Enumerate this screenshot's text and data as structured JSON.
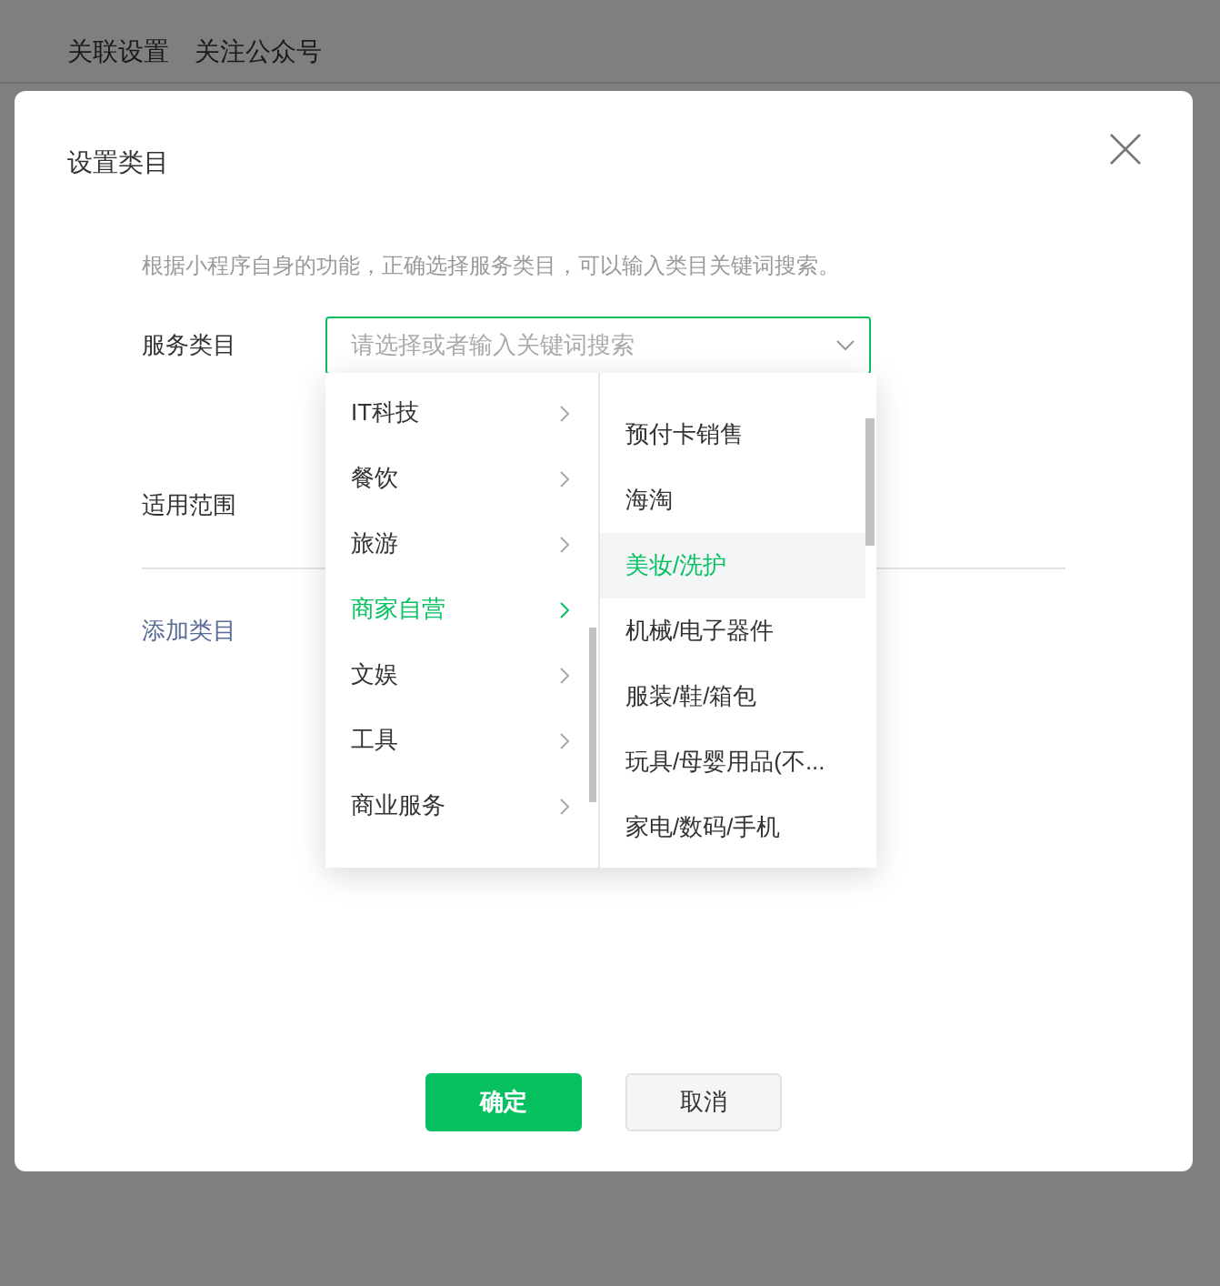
{
  "background_tabs": [
    "关联设置",
    "关注公众号"
  ],
  "dialog": {
    "title": "设置类目",
    "hint": "根据小程序自身的功能，正确选择服务类目，可以输入类目关键词搜索。",
    "service_label": "服务类目",
    "search": {
      "placeholder": "请选择或者输入关键词搜索"
    },
    "scope_label": "适用范围",
    "add_link": "添加类目",
    "categories": [
      {
        "label": "IT科技",
        "selected": false
      },
      {
        "label": "餐饮",
        "selected": false
      },
      {
        "label": "旅游",
        "selected": false
      },
      {
        "label": "商家自营",
        "selected": true
      },
      {
        "label": "文娱",
        "selected": false
      },
      {
        "label": "工具",
        "selected": false
      },
      {
        "label": "商业服务",
        "selected": false
      }
    ],
    "subcategories": [
      {
        "label": "预付卡销售",
        "selected": false
      },
      {
        "label": "海淘",
        "selected": false
      },
      {
        "label": "美妆/洗护",
        "selected": true
      },
      {
        "label": "机械/电子器件",
        "selected": false
      },
      {
        "label": "服装/鞋/箱包",
        "selected": false
      },
      {
        "label": "玩具/母婴用品(不...",
        "selected": false
      },
      {
        "label": "家电/数码/手机",
        "selected": false
      }
    ],
    "buttons": [
      {
        "label": "确定",
        "kind": "primary"
      },
      {
        "label": "取消",
        "kind": "secondary"
      }
    ]
  }
}
